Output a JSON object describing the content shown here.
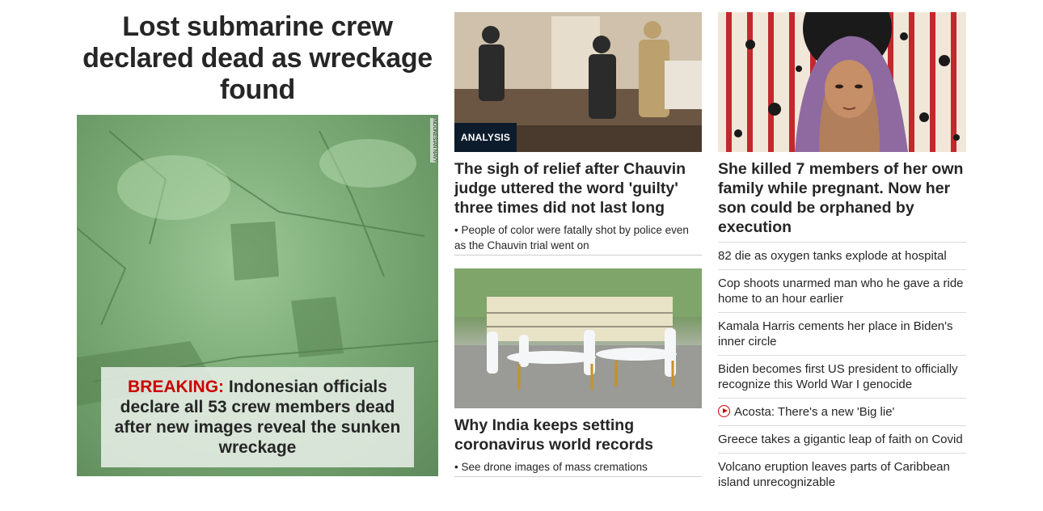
{
  "lead": {
    "headline": "Lost submarine crew declared dead as wreckage found",
    "image_credit": "INDONESIAN NAVY",
    "breaking_label": "BREAKING:",
    "breaking_text": "Indonesian officials declare all 53 crew members dead after new images reveal the sunken wreckage"
  },
  "column2": {
    "card1": {
      "tag": "ANALYSIS",
      "headline": "The sigh of relief after Chauvin judge uttered the word 'guilty' three times did not last long",
      "sub": "• People of color were fatally shot by police even as the Chauvin trial went on"
    },
    "card2": {
      "headline": "Why India keeps setting coronavirus world records",
      "sub": "• See drone images of mass cremations"
    }
  },
  "column3": {
    "headline": "She killed 7 members of her own family while pregnant. Now her son could be orphaned by execution",
    "items": [
      "82 die as oxygen tanks explode at hospital",
      "Cop shoots unarmed man who he gave a ride home to an hour earlier",
      "Kamala Harris cements her place in Biden's inner circle",
      "Biden becomes first US president to officially recognize this World War I genocide",
      "Acosta: There's a new 'Big lie'",
      "Greece takes a gigantic leap of faith on Covid",
      "Volcano eruption leaves parts of Caribbean island unrecognizable"
    ]
  },
  "colors": {
    "breaking_red": "#cc0000",
    "analysis_bg": "#0c1c2c",
    "text": "#262626"
  }
}
